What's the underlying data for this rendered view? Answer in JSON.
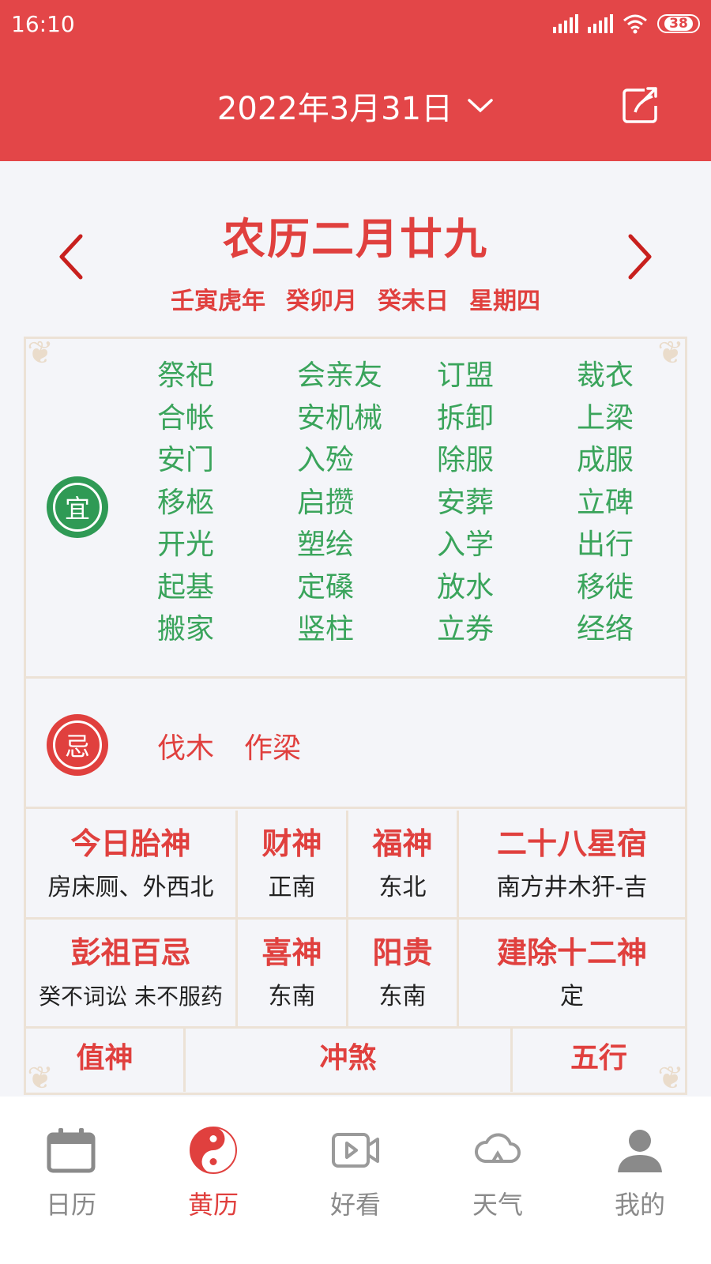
{
  "status_bar": {
    "time": "16:10",
    "battery": "38"
  },
  "header": {
    "date": "2022年3月31日"
  },
  "lunar": {
    "title": "农历二月廿九",
    "ganzhi": [
      "壬寅虎年",
      "癸卯月",
      "癸未日",
      "星期四"
    ]
  },
  "yi": {
    "badge": "宜",
    "items": [
      "祭祀",
      "会亲友",
      "订盟",
      "裁衣",
      "合帐",
      "安机械",
      "拆卸",
      "上梁",
      "安门",
      "入殓",
      "除服",
      "成服",
      "移柩",
      "启攒",
      "安葬",
      "立碑",
      "开光",
      "塑绘",
      "入学",
      "出行",
      "起基",
      "定磉",
      "放水",
      "移徙",
      "搬家",
      "竖柱",
      "立券",
      "经络"
    ]
  },
  "ji": {
    "badge": "忌",
    "items": [
      "伐木",
      "作梁"
    ]
  },
  "info": {
    "row1": [
      {
        "head": "今日胎神",
        "val": "房床厕、外西北"
      },
      {
        "head": "财神",
        "val": "正南"
      },
      {
        "head": "福神",
        "val": "东北"
      },
      {
        "head": "二十八星宿",
        "val": "南方井木犴-吉"
      }
    ],
    "row2": [
      {
        "head": "彭祖百忌",
        "val": "癸不词讼 未不服药"
      },
      {
        "head": "喜神",
        "val": "东南"
      },
      {
        "head": "阳贵",
        "val": "东南"
      },
      {
        "head": "建除十二神",
        "val": "定"
      }
    ],
    "row3": [
      "值神",
      "冲煞",
      "五行"
    ]
  },
  "bottom_nav": [
    {
      "label": "日历",
      "icon": "calendar-icon",
      "active": false
    },
    {
      "label": "黄历",
      "icon": "yin-yang-icon",
      "active": true
    },
    {
      "label": "好看",
      "icon": "video-icon",
      "active": false
    },
    {
      "label": "天气",
      "icon": "cloud-icon",
      "active": false
    },
    {
      "label": "我的",
      "icon": "user-icon",
      "active": false
    }
  ],
  "colors": {
    "primary_red": "#e34648",
    "text_red": "#e0403e",
    "yi_green": "#3aa45b",
    "frame": "#ece2d6"
  }
}
